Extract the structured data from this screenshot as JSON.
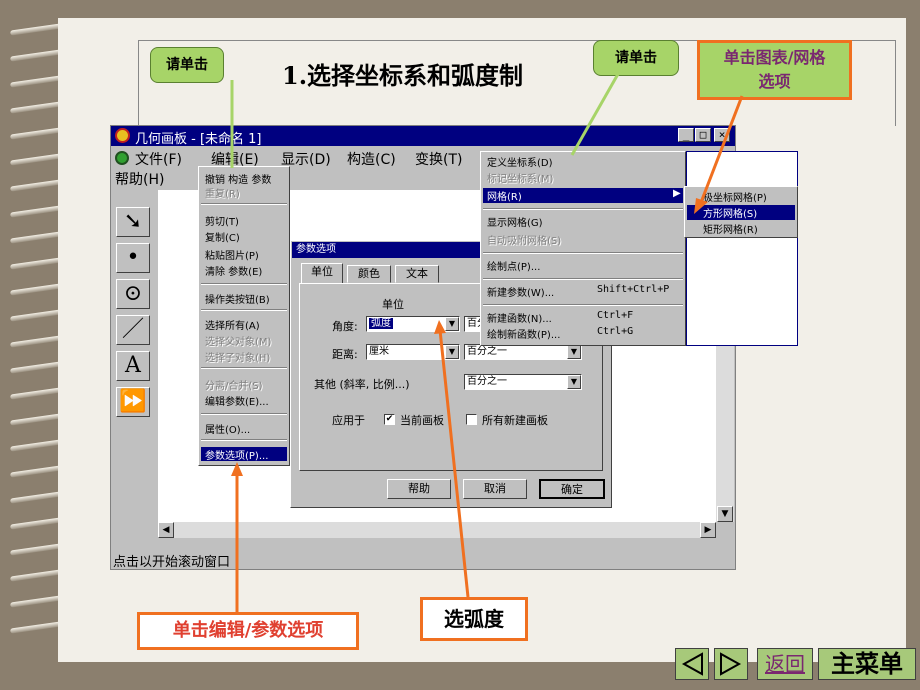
{
  "slide": {
    "heading": "1.选择坐标系和弧度制",
    "callout_left": "请单击",
    "callout_right": "请单击",
    "note_grid": "单击图表/网格选项",
    "note_edit": "单击编辑/参数选项",
    "note_radian": "选弧度",
    "nav_back": "返回",
    "nav_main": "主菜单",
    "nav_prev_icon": "triangle-left-icon",
    "nav_next_icon": "triangle-right-icon"
  },
  "window": {
    "title": "几何画板 - [未命名 1]",
    "menubar_row1": [
      "文件(F)",
      "编辑(E)",
      "显示(D)",
      "构造(C)",
      "变换(T)"
    ],
    "menubar_row2": [
      "帮助(H)"
    ],
    "status": "点击以开始滚动窗口"
  },
  "tools": [
    "arrow-tool-icon",
    "point-tool-icon",
    "compass-tool-icon",
    "line-tool-icon",
    "text-tool-icon",
    "script-tool-icon"
  ],
  "tool_glyphs": [
    "➘",
    "•",
    "⊙",
    "／",
    "A",
    "⏩"
  ],
  "edit_menu": [
    {
      "label": "撤销 构造 参数",
      "disabled": false
    },
    {
      "label": "重复(R)",
      "disabled": true
    },
    {
      "label": "剪切(T)",
      "disabled": false
    },
    {
      "label": "复制(C)",
      "disabled": false
    },
    {
      "label": "粘贴图片(P)",
      "disabled": false
    },
    {
      "label": "清除 参数(E)",
      "disabled": false
    },
    {
      "label": "操作类按钮(B)",
      "disabled": false
    },
    {
      "label": "选择所有(A)",
      "disabled": false
    },
    {
      "label": "选择父对象(M)",
      "disabled": true
    },
    {
      "label": "选择子对象(H)",
      "disabled": true
    },
    {
      "label": "分离/合并(S)",
      "disabled": true
    },
    {
      "label": "编辑参数(E)...",
      "disabled": false
    },
    {
      "label": "属性(O)...",
      "disabled": false
    },
    {
      "label": "参数选项(P)...",
      "disabled": false
    }
  ],
  "graph_menu": [
    {
      "label": "定义坐标系(D)",
      "disabled": false
    },
    {
      "label": "标记坐标系(M)",
      "disabled": true
    },
    {
      "label": "网格(R)",
      "disabled": false
    },
    {
      "label": "显示网格(G)",
      "disabled": false
    },
    {
      "label": "自动吸附网格(S)",
      "disabled": true
    },
    {
      "label": "绘制点(P)...",
      "disabled": false
    },
    {
      "label": "新建参数(W)...",
      "shortcut": "Shift+Ctrl+P",
      "disabled": false
    },
    {
      "label": "新建函数(N)...",
      "shortcut": "Ctrl+F",
      "disabled": false
    },
    {
      "label": "绘制新函数(P)...",
      "shortcut": "Ctrl+G",
      "disabled": false
    }
  ],
  "grid_submenu": [
    "极坐标网格(P)",
    "方形网格(S)",
    "矩形网格(R)"
  ],
  "dialog": {
    "title": "参数选项",
    "tabs": [
      "单位",
      "颜色",
      "文本"
    ],
    "group_title": "单位",
    "angle_label": "角度:",
    "angle_value": "弧度",
    "angle_precision": "百分之一",
    "distance_label": "距离:",
    "distance_value": "厘米",
    "distance_precision": "百分之一",
    "other_label": "其他 (斜率, 比例...)",
    "other_precision": "百分之一",
    "apply_label": "应用于",
    "current_canvas": "当前画板",
    "current_checked": true,
    "all_new": "所有新建画板",
    "all_new_checked": false,
    "help": "帮助",
    "cancel": "取消",
    "ok": "确定"
  }
}
